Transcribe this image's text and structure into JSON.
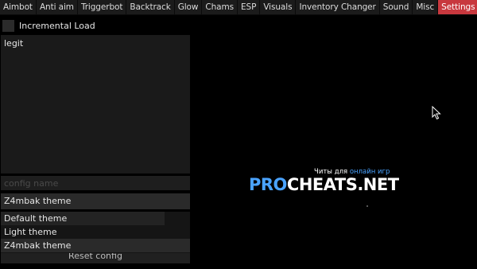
{
  "tabs": [
    {
      "label": "Aimbot",
      "active": false
    },
    {
      "label": "Anti aim",
      "active": false
    },
    {
      "label": "Triggerbot",
      "active": false
    },
    {
      "label": "Backtrack",
      "active": false
    },
    {
      "label": "Glow",
      "active": false
    },
    {
      "label": "Chams",
      "active": false
    },
    {
      "label": "ESP",
      "active": false
    },
    {
      "label": "Visuals",
      "active": false
    },
    {
      "label": "Inventory Changer",
      "active": false
    },
    {
      "label": "Sound",
      "active": false
    },
    {
      "label": "Misc",
      "active": false
    },
    {
      "label": "Settings",
      "active": true
    }
  ],
  "settings": {
    "incremental_load_label": "Incremental Load",
    "incremental_load_checked": false,
    "configs": [
      "legit"
    ],
    "config_name_placeholder": "config name",
    "theme_selected": "Z4mbak theme",
    "theme_options": [
      "Default theme",
      "Light theme",
      "Z4mbak theme"
    ],
    "reset_label": "Reset config"
  },
  "watermark": {
    "tagline_prefix": "Читы для",
    "tagline_accent": "онлайн игр",
    "logo_pro": "PRO",
    "logo_rest": "CHEATS.NET"
  },
  "colors": {
    "accent": "#c8383e",
    "watermark_blue": "#4aa3ff"
  }
}
